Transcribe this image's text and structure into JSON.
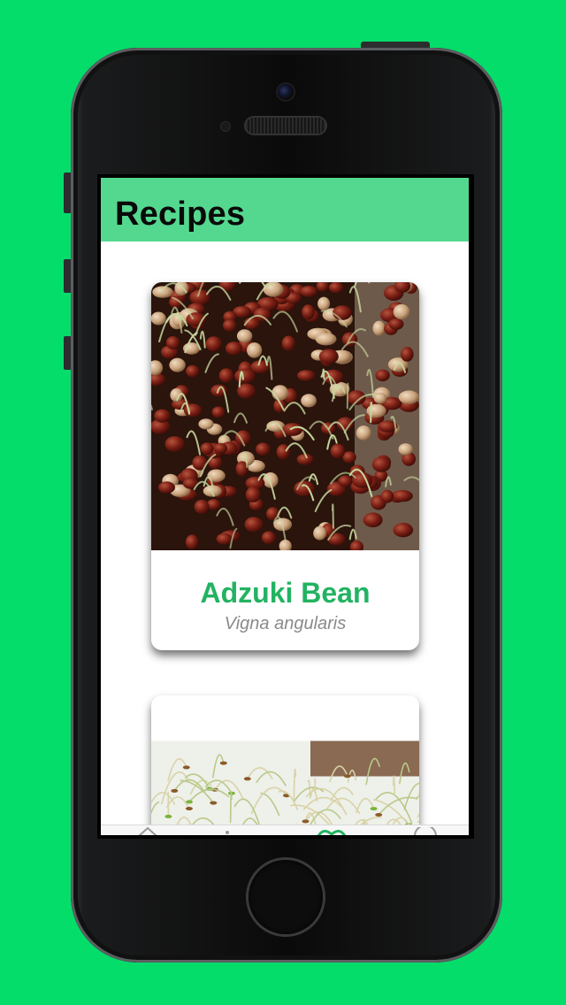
{
  "colors": {
    "background": "#05dd6a",
    "navbar": "#54d88f",
    "accent": "#22b361",
    "subtitle": "#8a8a8a"
  },
  "navbar": {
    "title": "Recipes"
  },
  "cards": [
    {
      "name": "Adzuki Bean",
      "latin": "Vigna angularis",
      "photo_icon": "sprouted-adzuki-beans-photo"
    },
    {
      "name": "",
      "latin": "",
      "photo_icon": "alfalfa-sprouts-photo"
    }
  ],
  "tabbar": {
    "items": [
      {
        "icon": "home-icon",
        "selected": false
      },
      {
        "icon": "list-icon",
        "selected": false
      },
      {
        "icon": "sprout-icon",
        "selected": true
      },
      {
        "icon": "info-icon",
        "selected": false
      }
    ]
  }
}
